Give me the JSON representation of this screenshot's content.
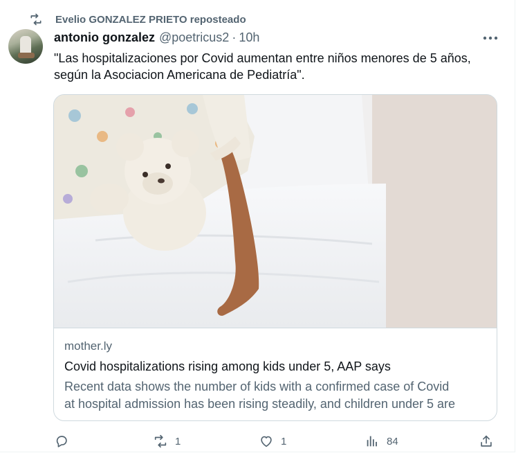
{
  "repost": {
    "text": "Evelio GONZALEZ PRIETO reposteado",
    "icon": "repost-icon"
  },
  "author": {
    "name": "antonio gonzalez",
    "handle": "@poetricus2",
    "separator": "·",
    "time": "10h"
  },
  "tweet": {
    "text": "\"Las hospitalizaciones por Covid aumentan entre niños menores de 5 años, según la Asociacion Americana de Pediatría\"."
  },
  "card": {
    "domain": "mother.ly",
    "title": "Covid hospitalizations rising among kids under 5, AAP says",
    "description_line1": "Recent data shows the number of kids with a confirmed case of Covid",
    "description_line2": "at hospital admission has been rising steadily, and children under 5 are"
  },
  "actions": {
    "reply": {
      "icon": "reply-icon",
      "count": ""
    },
    "repost": {
      "icon": "repost-icon",
      "count": "1"
    },
    "like": {
      "icon": "heart-icon",
      "count": "1"
    },
    "views": {
      "icon": "views-icon",
      "count": "84"
    },
    "share": {
      "icon": "share-icon"
    }
  },
  "colors": {
    "text": "#0f1419",
    "secondary": "#536471",
    "border": "#cfd9de"
  }
}
